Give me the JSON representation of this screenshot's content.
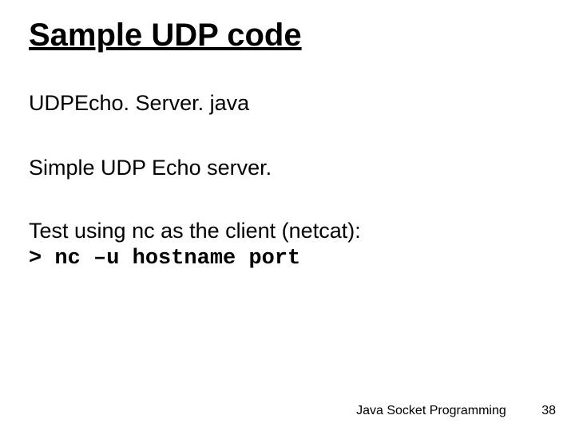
{
  "title": "Sample UDP code",
  "body": {
    "filename": "UDPEcho. Server. java",
    "desc": "Simple UDP Echo server.",
    "test_line": "Test using nc as the client (netcat):",
    "cmd": "> nc –u hostname port"
  },
  "footer": {
    "text": "Java Socket Programming",
    "page": "38"
  }
}
